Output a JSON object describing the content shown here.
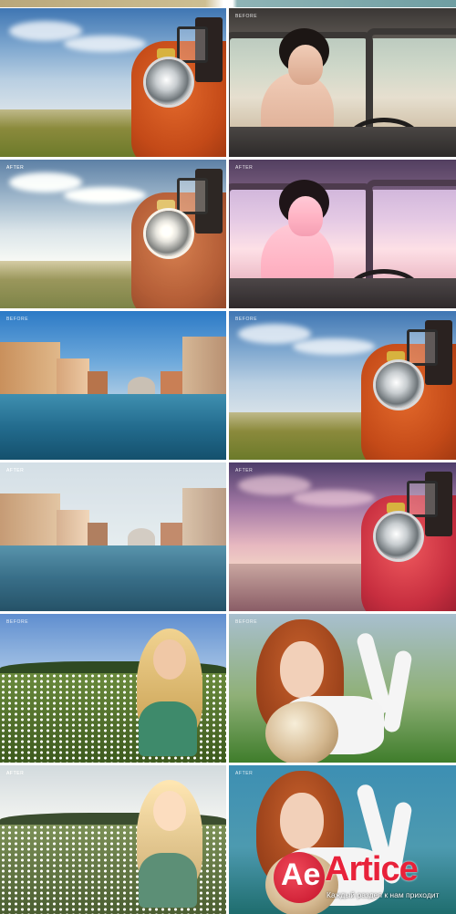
{
  "labels": {
    "before": "BEFORE",
    "after": "AFTER"
  },
  "grid": [
    {
      "col": "left",
      "scene": "red-truck-field",
      "label": "",
      "grade": "original"
    },
    {
      "col": "right",
      "scene": "girl-in-van",
      "label": "BEFORE",
      "grade": "original"
    },
    {
      "col": "left",
      "scene": "red-truck-field",
      "label": "AFTER",
      "grade": "faded"
    },
    {
      "col": "right",
      "scene": "girl-in-van",
      "label": "AFTER",
      "grade": "magenta"
    },
    {
      "col": "left",
      "scene": "venice-canal",
      "label": "BEFORE",
      "grade": "original"
    },
    {
      "col": "right",
      "scene": "red-truck-field",
      "label": "BEFORE",
      "grade": "original"
    },
    {
      "col": "left",
      "scene": "venice-canal",
      "label": "AFTER",
      "grade": "muted"
    },
    {
      "col": "right",
      "scene": "red-truck-field",
      "label": "AFTER",
      "grade": "purple-sunset"
    },
    {
      "col": "left",
      "scene": "woman-in-daisies",
      "label": "BEFORE",
      "grade": "original"
    },
    {
      "col": "right",
      "scene": "redhead-with-ball",
      "label": "BEFORE",
      "grade": "original"
    },
    {
      "col": "left",
      "scene": "woman-in-daisies",
      "label": "AFTER",
      "grade": "faded"
    },
    {
      "col": "right",
      "scene": "redhead-with-ball",
      "label": "AFTER",
      "grade": "teal-vivid"
    }
  ],
  "watermark": {
    "logo_glyph": "Ae",
    "name": "Artice",
    "subtitle": "Каждый раздел к нам приходит"
  },
  "colors": {
    "truck_red": "#c44a18",
    "watermark_red": "#e8223a"
  }
}
